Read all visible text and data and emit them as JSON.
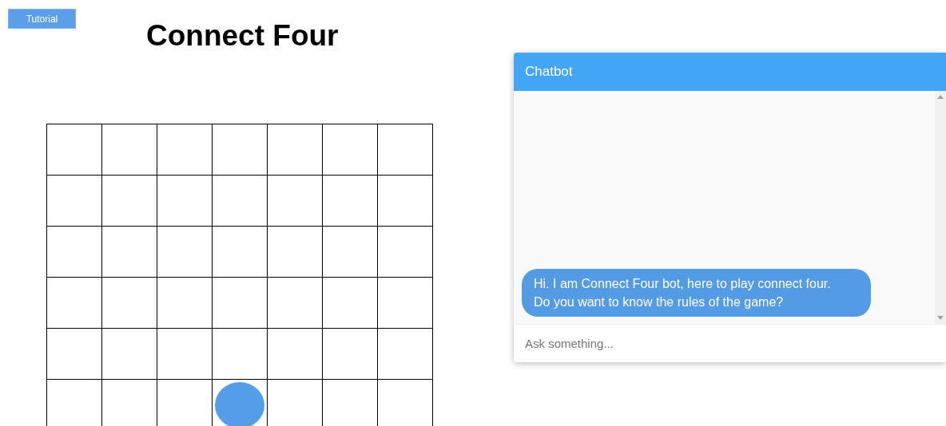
{
  "tutorial_button": {
    "label": "Tutorial"
  },
  "title": "Connect Four",
  "board": {
    "rows": [
      {
        "cells": [
          {
            "disc": false
          },
          {
            "disc": false
          },
          {
            "disc": false
          },
          {
            "disc": false
          },
          {
            "disc": false
          },
          {
            "disc": false
          },
          {
            "disc": false
          }
        ]
      },
      {
        "cells": [
          {
            "disc": false
          },
          {
            "disc": false
          },
          {
            "disc": false
          },
          {
            "disc": false
          },
          {
            "disc": false
          },
          {
            "disc": false
          },
          {
            "disc": false
          }
        ]
      },
      {
        "cells": [
          {
            "disc": false
          },
          {
            "disc": false
          },
          {
            "disc": false
          },
          {
            "disc": false
          },
          {
            "disc": false
          },
          {
            "disc": false
          },
          {
            "disc": false
          }
        ]
      },
      {
        "cells": [
          {
            "disc": false
          },
          {
            "disc": false
          },
          {
            "disc": false
          },
          {
            "disc": false
          },
          {
            "disc": false
          },
          {
            "disc": false
          },
          {
            "disc": false
          }
        ]
      },
      {
        "cells": [
          {
            "disc": false
          },
          {
            "disc": false
          },
          {
            "disc": false
          },
          {
            "disc": false
          },
          {
            "disc": false
          },
          {
            "disc": false
          },
          {
            "disc": false
          }
        ]
      },
      {
        "cells": [
          {
            "disc": false
          },
          {
            "disc": false
          },
          {
            "disc": false
          },
          {
            "disc": true
          },
          {
            "disc": false
          },
          {
            "disc": false
          },
          {
            "disc": false
          }
        ]
      }
    ]
  },
  "chatbot": {
    "title": "Chatbot",
    "messages": [
      {
        "lines": [
          "Hi. I am Connect Four bot, here to play connect four.",
          "Do you want to know the rules of the game?"
        ]
      }
    ],
    "input": {
      "placeholder": "Ask something..."
    }
  }
}
